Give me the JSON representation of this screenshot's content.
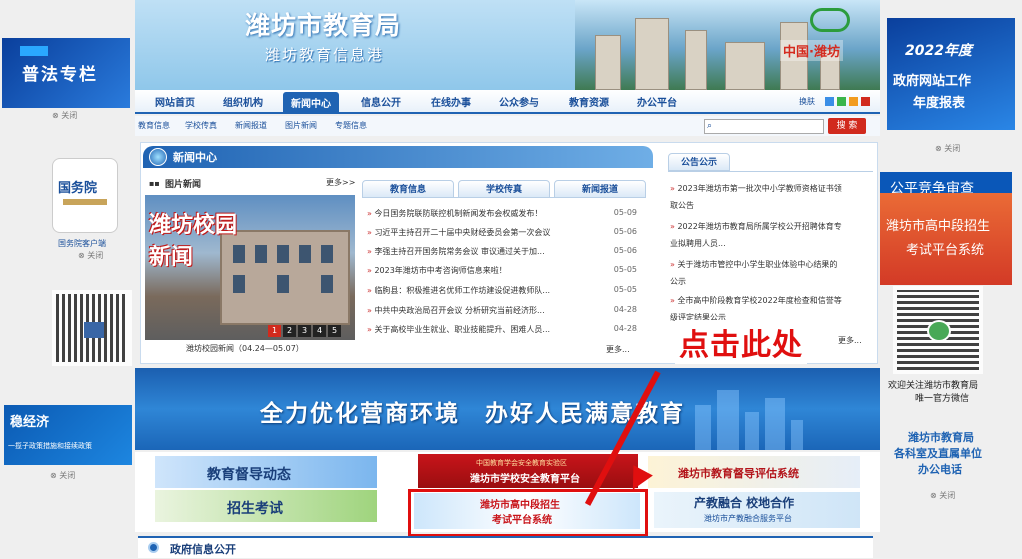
{
  "header": {
    "title": "潍坊市教育局",
    "subtitle": "潍坊教育信息港",
    "region": "中国·潍坊"
  },
  "nav": {
    "items": [
      "网站首页",
      "组织机构",
      "新闻中心",
      "信息公开",
      "在线办事",
      "公众参与",
      "教育资源",
      "办公平台"
    ],
    "active_index": 2,
    "skin_label": "换肤"
  },
  "subnav": {
    "items": [
      "教育信息",
      "学校传真",
      "新闻报道",
      "图片新闻",
      "专题信息"
    ]
  },
  "search": {
    "button": "搜 索",
    "placeholder": ""
  },
  "left_ads": {
    "pufa": "普法专栏",
    "gwy": "国务院",
    "gwy_sub": "国务院客户端",
    "wjj": "稳经济",
    "wjj_sub": "一揽子政策措施和接续政策",
    "close": "关闭"
  },
  "news": {
    "section_title": "新闻中心",
    "photo_title": "图片新闻",
    "more": "更多>>",
    "photo_overlay_1": "潍坊校园",
    "photo_overlay_2": "新闻",
    "photo_caption": "潍坊校园新闻（04.24—05.07）",
    "pages": [
      "1",
      "2",
      "3",
      "4",
      "5"
    ],
    "active_page": 0,
    "tabs": [
      "教育信息",
      "学校传真",
      "新闻报道"
    ],
    "items": [
      {
        "title": "今日国务院联防联控机制新闻发布会权威发布！",
        "date": "05-09"
      },
      {
        "title": "习近平主持召开二十届中央财经委员会第一次会议",
        "date": "05-06"
      },
      {
        "title": "李强主持召开国务院常务会议 审议通过关于加...",
        "date": "05-06"
      },
      {
        "title": "2023年潍坊市中考咨询师信息来啦！",
        "date": "05-05"
      },
      {
        "title": "临朐县：积极推进名优师工作坊建设促进教师队...",
        "date": "05-05"
      },
      {
        "title": "中共中央政治局召开会议 分析研究当前经济形...",
        "date": "04-28"
      },
      {
        "title": "关于高校毕业生就业、职业技能提升、困难人员...",
        "date": "04-28"
      }
    ],
    "more2": "更多..."
  },
  "notice": {
    "title": "公告公示",
    "items": [
      "2023年潍坊市第一批次中小学教师资格证书领取公告",
      "2022年潍坊市教育局所属学校公开招聘体育专业拟聘用人员...",
      "关于潍坊市管控中小学生职业体验中心结果的公示",
      "全市高中阶段教育学校2022年度检查和信誉等级评定结果公示"
    ],
    "more": "更多..."
  },
  "annotation": "点击此处",
  "banner": {
    "text": "全力优化营商环境　办好人民满意教育"
  },
  "tiles": {
    "dudao": "教育督导动态",
    "zhaosheng": "招生考试",
    "safety_top": "中国教育学会安全教育实验区",
    "safety": "潍坊市学校安全教育平台",
    "pinggu": "潍坊市教育督导评估系统",
    "gaozhong_1": "潍坊市高中段招生",
    "gaozhong_2": "考试平台系统",
    "chanjiao": "产教融合 校地合作",
    "chanjiao_sub": "潍坊市产教融合服务平台"
  },
  "right_ads": {
    "report_year": "2022年度",
    "report_1": "政府网站工作",
    "report_2": "年度报表",
    "gongping": "公平竞争审查",
    "gz_1": "潍坊市高中段招生",
    "gz_2": "考试平台系统",
    "wechat_1": "欢迎关注潍坊市教育局",
    "wechat_2": "唯一官方微信",
    "ks_1": "潍坊市教育局",
    "ks_2": "各科室及直属单位",
    "ks_3": "办公电话",
    "close": "关闭"
  },
  "gov_info": {
    "title": "政府信息公开"
  },
  "colors": {
    "primary": "#1f63b3",
    "red": "#d12a1d"
  }
}
